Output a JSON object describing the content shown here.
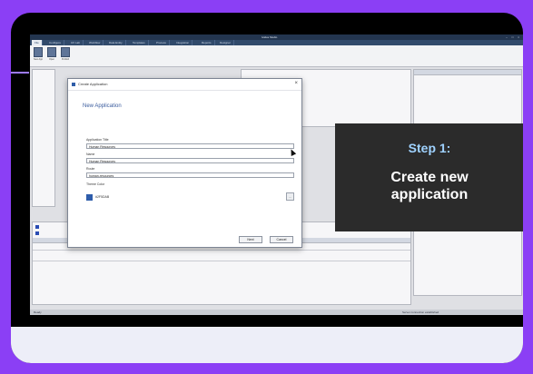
{
  "app": {
    "window_title": "Ivalua Studio",
    "window_buttons": "–  □  ×",
    "menu_tabs": [
      "File",
      "Configure",
      "UX Lab",
      "Workflow",
      "Data Entity",
      "Templates",
      "Process",
      "Integration",
      "Reports",
      "Designer"
    ],
    "ribbon_buttons": [
      {
        "label": "New App"
      },
      {
        "label": "Open"
      },
      {
        "label": "Publish"
      }
    ],
    "status_text": "Ready",
    "status_right": "Server connection established"
  },
  "dialog": {
    "title": "Create Application",
    "close_glyph": "×",
    "heading": "New Application",
    "fields": [
      {
        "label": "Application Title",
        "value": "Human Resources"
      },
      {
        "label": "Name",
        "value": "Human Resources"
      },
      {
        "label": "Route",
        "value": "human-resources"
      }
    ],
    "theme": {
      "label": "Theme Color",
      "hex": "#2F5DAB",
      "picker_glyph": "…"
    },
    "buttons": {
      "next": "Next",
      "cancel": "Cancel"
    }
  },
  "overlay": {
    "step": "Step 1:",
    "line1": "Create new",
    "line2": "application"
  },
  "colors": {
    "frame_bg": "#8b3ff5",
    "overlay_bg": "#2b2b2b",
    "step_color": "#9fd2ff",
    "accent_blue": "#2e5dab"
  }
}
